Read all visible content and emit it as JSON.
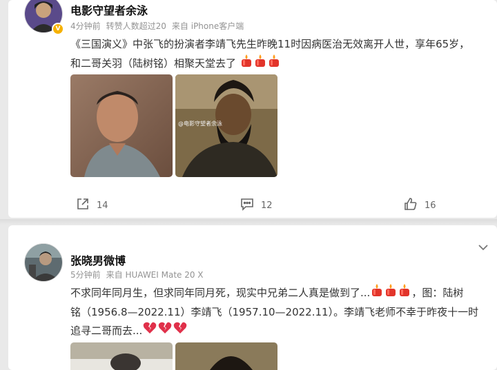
{
  "posts": [
    {
      "author": "电影守望者余泳",
      "time": "4分钟前",
      "repost_note": "转赞人数超过20",
      "source": "来自 iPhone客户端",
      "text_line1": "《三国演义》中张飞的扮演者李靖飞先生昨晚11时因病医治无效离开人世，享年65岁，",
      "text_line2": "和二哥关羽（陆树铭）相聚天堂去了",
      "emoji": [
        "candle",
        "candle",
        "candle"
      ],
      "watermark": "@电影守望者余泳",
      "actions": {
        "repost_count": "14",
        "comment_count": "12",
        "like_count": "16"
      },
      "icons": [
        "repost-icon",
        "comment-icon",
        "like-icon"
      ]
    },
    {
      "author": "张晓男微博",
      "time": "5分钟前",
      "source": "来自 HUAWEI Mate 20 X",
      "text_line1a": "不求同年同月生，但求同年同月死，现实中兄弟二人真是做到了...",
      "text_line1b": "，图：陆树",
      "text_line2": "铭（1956.8—2022.11）李靖飞（1957.10—2022.11）。李靖飞老师不幸于昨夜十一时",
      "text_line3": "追寻二哥而去...",
      "emoji_candles": [
        "candle",
        "candle",
        "candle"
      ],
      "emoji_hearts": [
        "broken-heart",
        "broken-heart",
        "broken-heart"
      ]
    }
  ],
  "colors": {
    "background": "#e9e9e9",
    "card": "#ffffff",
    "meta": "#939393",
    "text": "#333333",
    "badge": "#f6b100"
  }
}
